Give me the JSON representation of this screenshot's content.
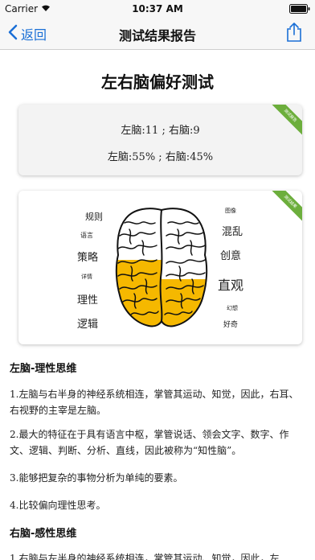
{
  "status_bar": {
    "carrier": "Carrier",
    "time": "10:37 AM"
  },
  "nav": {
    "back_label": "返回",
    "title": "测试结果报告"
  },
  "page": {
    "title": "左右脑偏好测试"
  },
  "score_card": {
    "counts_line": "左脑:11 ; 右脑:9",
    "percent_line": "左脑:55% ; 右脑:45%",
    "ribbon_text": "测试报告",
    "left_brain_percent": 55
  },
  "brain_card": {
    "ribbon_text": "测试结果",
    "left_words": [
      "规则",
      "语言",
      "策略",
      "详情",
      "理性",
      "逻辑"
    ],
    "right_words": [
      "图像",
      "混乱",
      "创意",
      "直观",
      "幻想",
      "好奇"
    ]
  },
  "sections": [
    {
      "title": "左脑-理性思维",
      "paragraphs": [
        "1.左脑与右半身的神经系统相连，掌管其运动、知觉，因此，右耳、右视野的主宰是左脑。",
        "2.最大的特征在于具有语言中枢，掌管说话、领会文字、数字、作文、逻辑、判断、分析、直线，因此被称为“知性脑”。",
        "3.能够把复杂的事物分析为单纯的要素。",
        "4.比较偏向理性思考。"
      ]
    },
    {
      "title": "右脑-感性思维",
      "paragraphs": [
        "1.右脑与左半身的神经系统相连，掌管其运动、知觉，因此，左"
      ]
    }
  ],
  "colors": {
    "accent": "#1a6fd6",
    "brain_fill": "#f5b800",
    "ribbon": "#6cae3c"
  }
}
